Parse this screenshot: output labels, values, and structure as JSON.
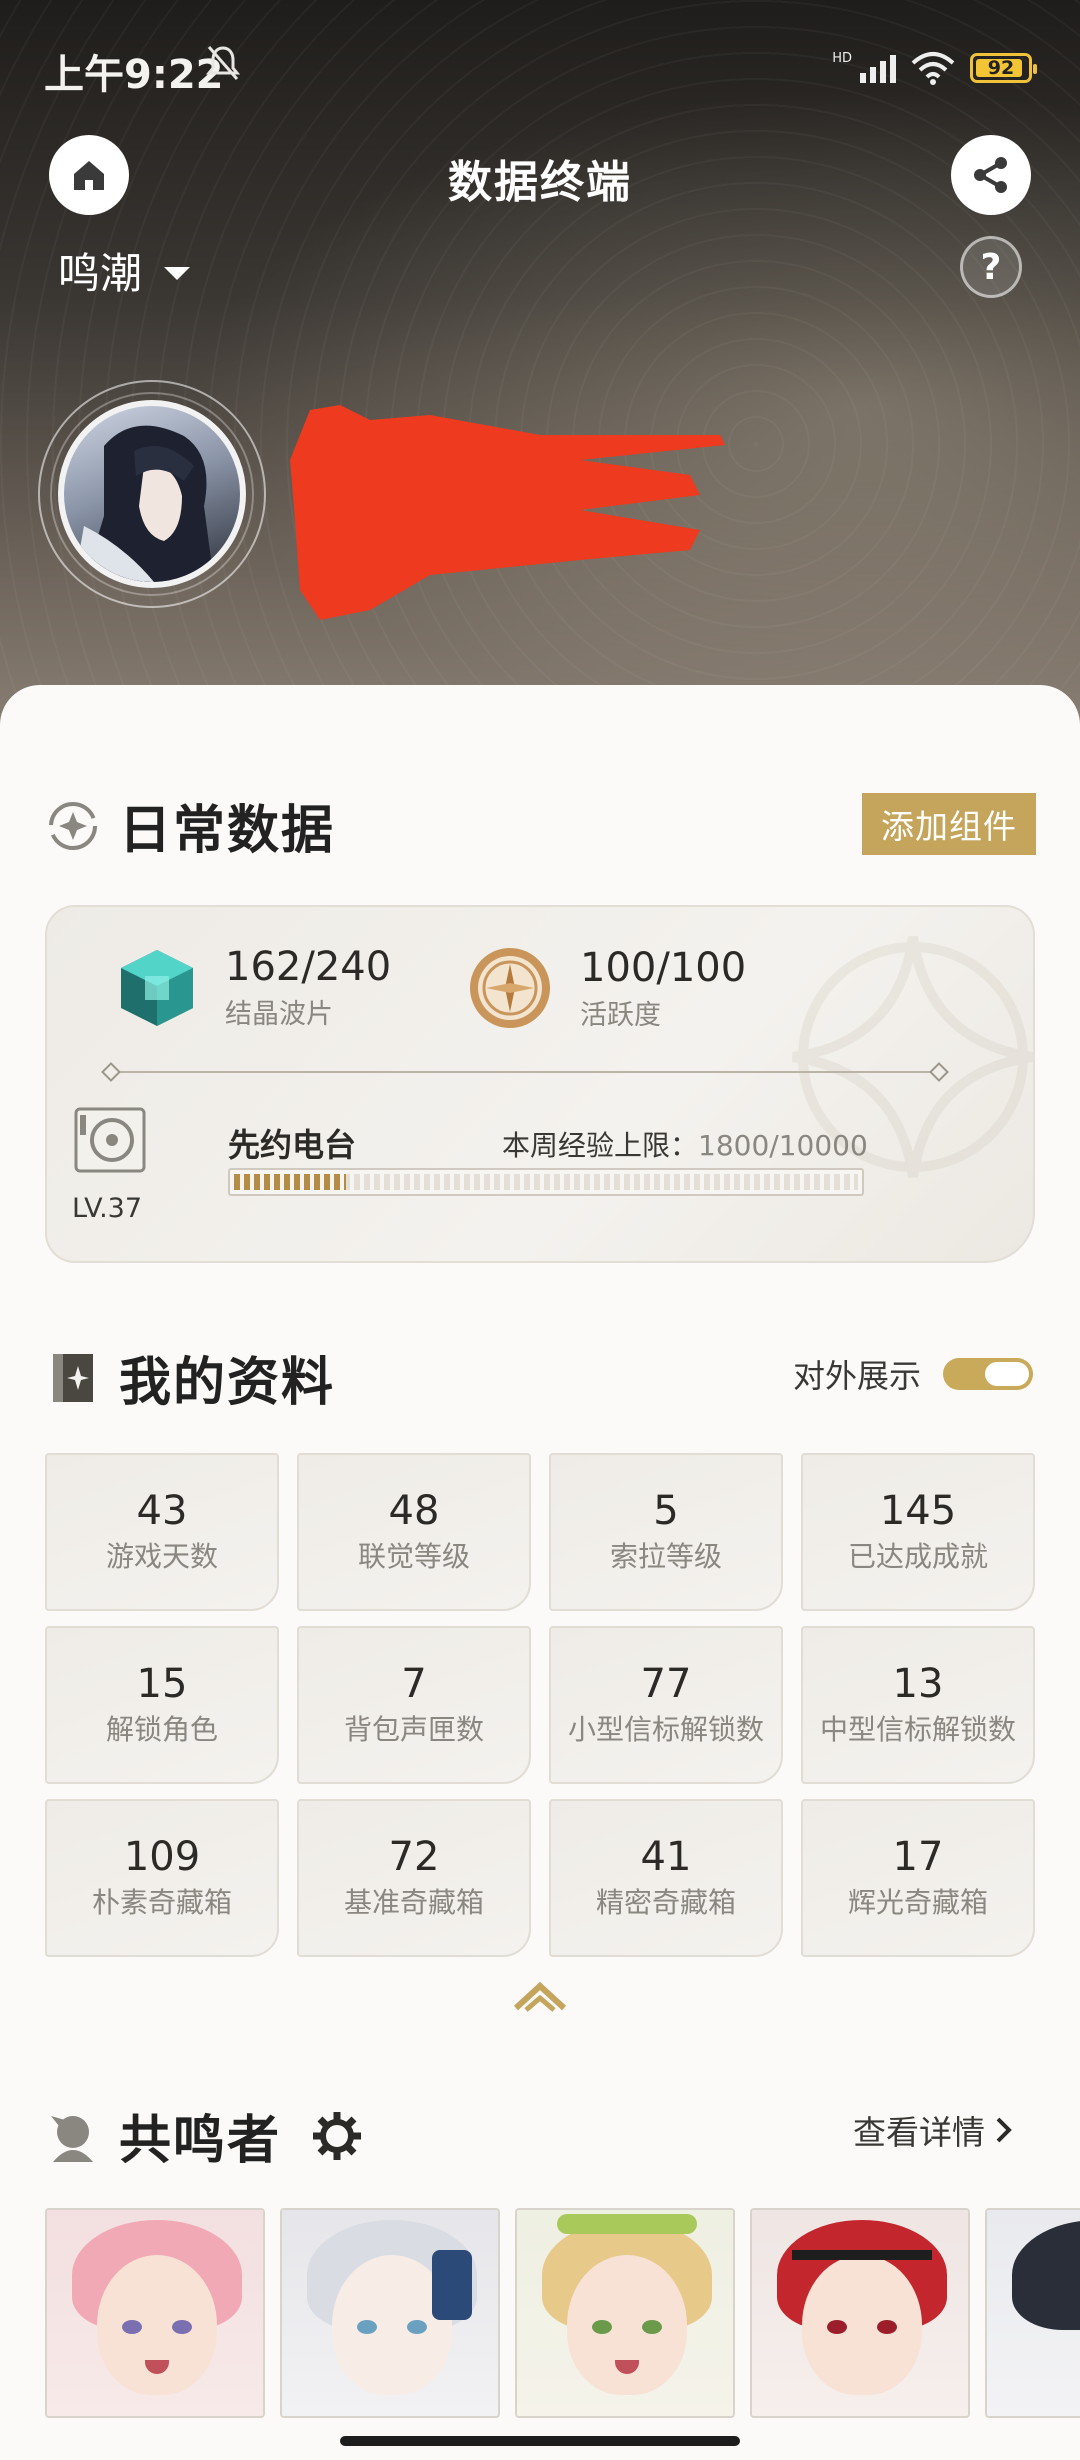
{
  "status": {
    "time": "上午9:22",
    "network": "HD",
    "battery": "92"
  },
  "header": {
    "title": "数据终端",
    "game": "鸣潮",
    "help": "?"
  },
  "daily": {
    "title": "日常数据",
    "add_widget": "添加组件",
    "crystal_value": "162/240",
    "crystal_label": "结晶波片",
    "activity_value": "100/100",
    "activity_label": "活跃度",
    "radio_title": "先约电台",
    "radio_level": "LV.37",
    "exp_label": "本周经验上限：",
    "exp_value": "1800/10000",
    "exp_progress": 0.18
  },
  "profile": {
    "title": "我的资料",
    "toggle_label": "对外展示",
    "toggle_on": true,
    "stats": [
      {
        "value": "43",
        "label": "游戏天数"
      },
      {
        "value": "48",
        "label": "联觉等级"
      },
      {
        "value": "5",
        "label": "索拉等级"
      },
      {
        "value": "145",
        "label": "已达成成就"
      },
      {
        "value": "15",
        "label": "解锁角色"
      },
      {
        "value": "7",
        "label": "背包声匣数"
      },
      {
        "value": "77",
        "label": "小型信标解锁数"
      },
      {
        "value": "13",
        "label": "中型信标解锁数"
      },
      {
        "value": "109",
        "label": "朴素奇藏箱"
      },
      {
        "value": "72",
        "label": "基准奇藏箱"
      },
      {
        "value": "41",
        "label": "精密奇藏箱"
      },
      {
        "value": "17",
        "label": "辉光奇藏箱"
      }
    ]
  },
  "resonators": {
    "title": "共鸣者",
    "details": "查看详情"
  },
  "colors": {
    "accent": "#c4a55b",
    "progress": "#b38d46"
  }
}
